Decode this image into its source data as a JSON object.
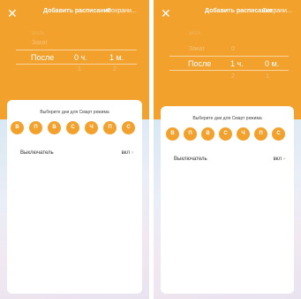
{
  "colors": {
    "accent": "#f2a12c"
  },
  "screens": [
    {
      "header": {
        "close_icon": "close-icon",
        "title": "Добавить расписание",
        "save_label": "Сохрани..."
      },
      "picker": {
        "faint_top": "Восх.",
        "above": "Закат",
        "selected_mode": "После",
        "selected_hours": "0",
        "hours_unit": "ч.",
        "selected_minutes": "1",
        "minutes_unit": "м.",
        "below_hours": "1",
        "below_minutes": "2"
      },
      "card": {
        "title": "Выберите дни для Смарт режима",
        "days": [
          "В",
          "П",
          "В",
          "С",
          "Ч",
          "П",
          "С"
        ],
        "switch_label": "Выключатель",
        "switch_value": "вкл"
      }
    },
    {
      "header": {
        "close_icon": "close-icon",
        "title": "Добавить расписание",
        "save_label": "Сохрани..."
      },
      "picker": {
        "faint_top": "Восх.",
        "above": "Закат",
        "selected_mode": "После",
        "selected_hours": "1",
        "hours_unit": "ч.",
        "selected_minutes": "0",
        "minutes_unit": "м.",
        "above_hours": "0",
        "below_hours": "2",
        "below_minutes": "1"
      },
      "card": {
        "title": "Выберите дни для Смарт режима",
        "days": [
          "В",
          "П",
          "В",
          "С",
          "Ч",
          "П",
          "С"
        ],
        "switch_label": "Выключатель",
        "switch_value": "вкл"
      }
    }
  ]
}
